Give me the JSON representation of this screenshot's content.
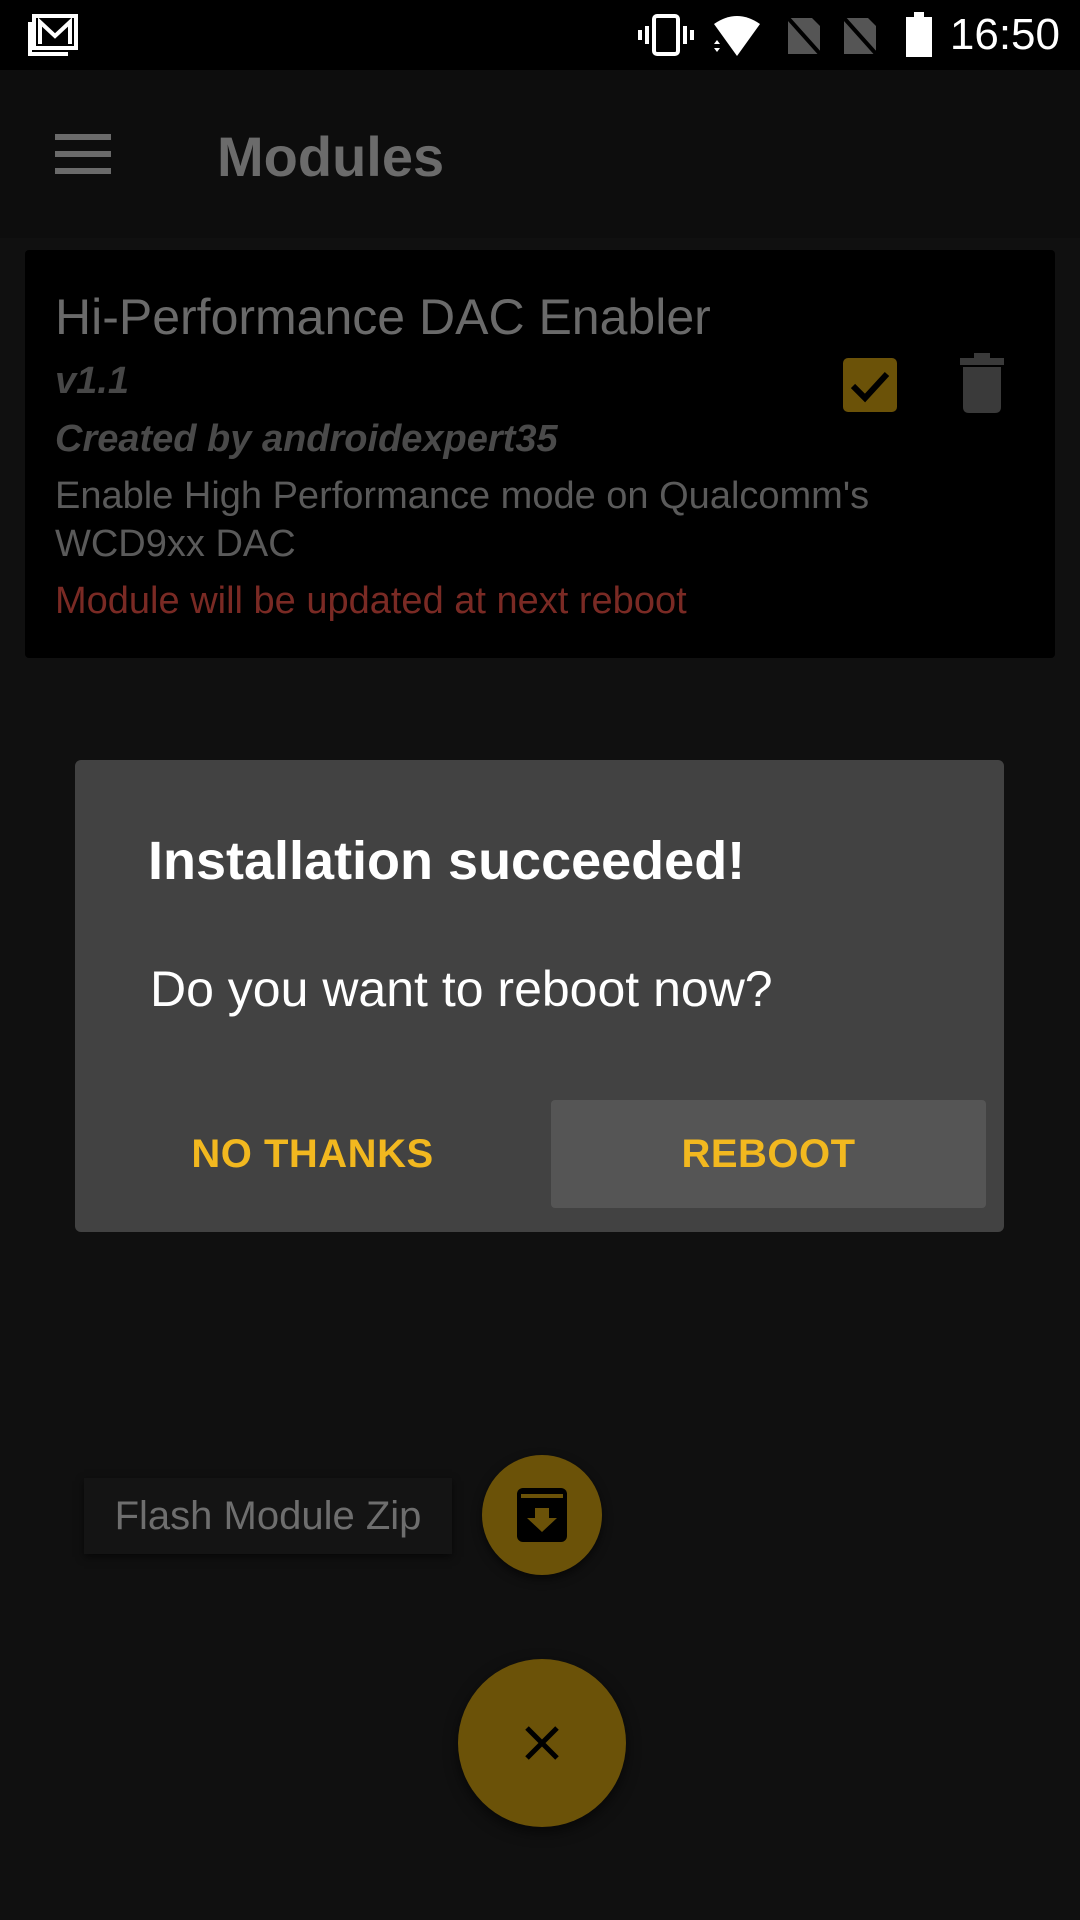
{
  "status_bar": {
    "time": "16:50",
    "icons": [
      "gmail-icon",
      "vibrate-icon",
      "wifi-icon",
      "no-sim-icon",
      "no-sim-icon",
      "battery-icon"
    ]
  },
  "app_bar": {
    "title": "Modules",
    "menu_icon": "hamburger-menu-icon"
  },
  "module": {
    "name": "Hi-Performance DAC Enabler",
    "version": "v1.1",
    "author": "Created by androidexpert35",
    "description": "Enable High Performance mode on Qualcomm's WCD9xx DAC",
    "status": "Module will be updated at next reboot",
    "enabled": true,
    "status_color": "#7a2a24"
  },
  "dialog": {
    "title": "Installation succeeded!",
    "message": "Do you want to reboot now?",
    "negative_button": "NO THANKS",
    "positive_button": "REBOOT",
    "accent_color": "#f2b81f"
  },
  "fab": {
    "flash_label": "Flash Module Zip",
    "flash_icon": "archive-download-icon",
    "close_icon": "close-icon"
  },
  "colors": {
    "accent_dimmed": "#6b5208",
    "background": "#101010"
  }
}
